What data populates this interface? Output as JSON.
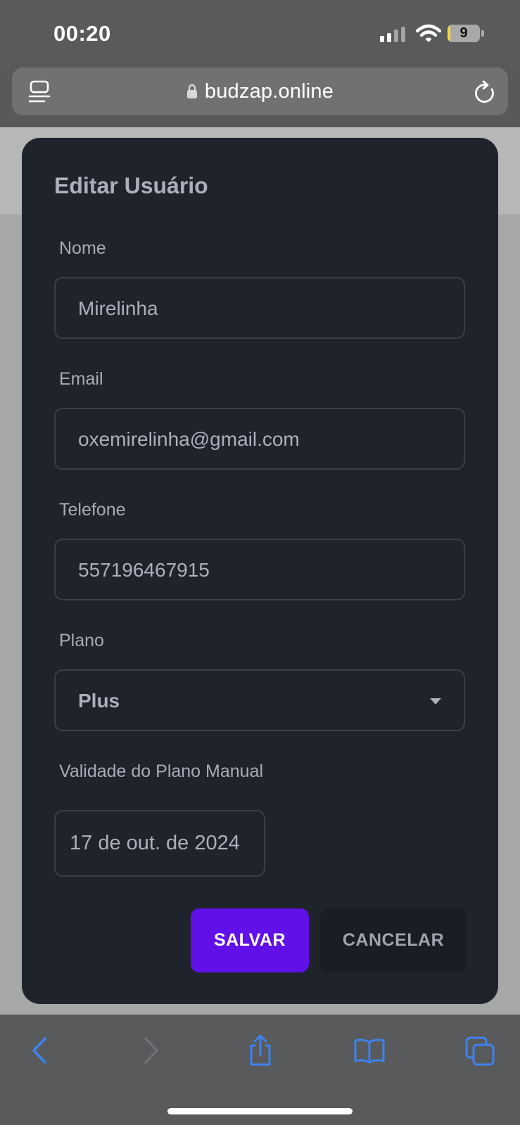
{
  "status_bar": {
    "time": "00:20",
    "battery_level": "9",
    "battery_fraction": 0.09
  },
  "browser": {
    "url": "budzap.online",
    "icons": {
      "reader": "reader-mode-icon",
      "lock": "lock-icon",
      "reload": "reload-icon"
    }
  },
  "modal": {
    "title": "Editar Usuário",
    "fields": {
      "nome": {
        "label": "Nome",
        "value": "Mirelinha"
      },
      "email": {
        "label": "Email",
        "value": "oxemirelinha@gmail.com"
      },
      "telefone": {
        "label": "Telefone",
        "value": "557196467915"
      },
      "plano": {
        "label": "Plano",
        "value": "Plus"
      },
      "validade": {
        "label": "Validade do Plano Manual",
        "value": "17 de out. de 2024"
      }
    },
    "buttons": {
      "save": "SALVAR",
      "cancel": "CANCELAR"
    }
  },
  "toolbar": {
    "icons": [
      "back-icon",
      "forward-icon",
      "share-icon",
      "bookmarks-icon",
      "tabs-icon"
    ]
  },
  "colors": {
    "accent": "#6111e8",
    "modal_bg": "#1f232b",
    "toolbar_icon": "#3d82f0"
  }
}
